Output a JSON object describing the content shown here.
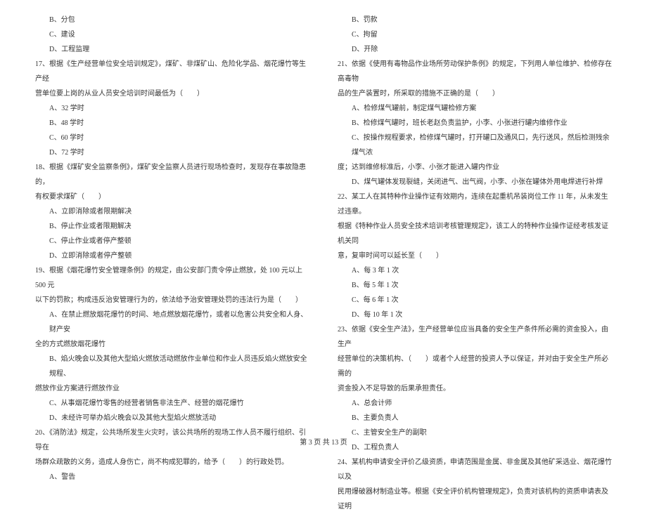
{
  "left": {
    "l1": "B、分包",
    "l2": "C、建设",
    "l3": "D、工程监理",
    "l4": "17、根据《生产经营单位安全培训规定》，煤矿、非煤矿山、危险化学品、烟花爆竹等生产经",
    "l5": "营单位要上岗的从业人员安全培训时间最低为（　　）",
    "l6": "A、32 学时",
    "l7": "B、48 学时",
    "l8": "C、60 学时",
    "l9": "D、72 学时",
    "l10": "18、根据《煤矿安全监察条例》，煤矿安全监察人员进行现场检查时，发现存在事故隐患的，",
    "l11": "有权要求煤矿（　　）",
    "l12": "A、立即消除或者限期解决",
    "l13": "B、停止作业或者限期解决",
    "l14": "C、停止作业或者停产整顿",
    "l15": "D、立即消除或者停产整顿",
    "l16": "19、根据《烟花爆竹安全管理条例》的规定，由公安部门责令停止燃放，处 100 元以上 500 元",
    "l17": "以下的罚款；构成违反治安管理行为的，依法给予治安管理处罚的违法行为是（　　）",
    "l18": "A、在禁止燃放烟花爆竹的时间、地点燃放烟花爆竹，或者以危害公共安全和人身、财产安",
    "l19": "全的方式燃放烟花爆竹",
    "l20": "B、焰火晚会以及其他大型焰火燃放活动燃放作业单位和作业人员违反焰火燃放安全规程、",
    "l21": "燃放作业方案进行燃放作业",
    "l22": "C、从事烟花爆竹零售的经营者销售非法生产、经营的烟花爆竹",
    "l23": "D、未经许可举办焰火晚会以及其他大型焰火燃放活动",
    "l24": "20、《消防法》规定，公共场所发生火灾时，该公共场所的现场工作人员不履行组织、引导在",
    "l25": "场群众疏散的义务，造成人身伤亡，尚不构成犯罪的，给予（　　）的行政处罚。",
    "l26": "A、警告"
  },
  "right": {
    "r1": "B、罚款",
    "r2": "C、拘留",
    "r3": "D、开除",
    "r4": "21、依据《使用有毒物品作业场所劳动保护条例》的规定，下列用人单位维护、检修存在高毒物",
    "r5": "品的生产装置时，所采取的措施不正确的是（　　）",
    "r6": "A、检修煤气罐前，制定煤气罐检修方案",
    "r7": "B、检修煤气罐时，班长老赵负责监护，小李、小张进行罐内维修作业",
    "r8": "C、按操作规程要求，检修煤气罐时，打开罐口及通风口，先行送风，然后检测残余煤气浓",
    "r9": "度；达到维修标准后，小李、小张才能进入罐内作业",
    "r10": "D、煤气罐体发现裂缝，关闭进气、出气阀，小李、小张在罐体外用电焊进行补焊",
    "r11": "22、某工人在其特种作业操作证有效期内，连续在起重机吊装岗位工作 11 年，从未发生过违章。",
    "r12": "根据《特种作业人员安全技术培训考核管理规定》，该工人的特种作业操作证经考核发证机关同",
    "r13": "意，复审时间可以延长至（　　）",
    "r14": "A、每 3 年 1 次",
    "r15": "B、每 5 年 1 次",
    "r16": "C、每 6 年 1 次",
    "r17": "D、每 10 年 1 次",
    "r18": "23、依据《安全生产法》，生产经营单位应当具备的安全生产条件所必需的资金投入，由生产",
    "r19": "经营单位的决策机构、（　　）或者个人经营的投资人予以保证，并对由于安全生产所必需的",
    "r20": "资金投入不足导致的后果承担责任。",
    "r21": "A、总会计师",
    "r22": "B、主要负责人",
    "r23": "C、主管安全生产的副职",
    "r24": "D、工程负责人",
    "r25": "24、某机构申请安全评价乙级资质，申请范围是金属、非金属及其他矿采选业、烟花爆竹以及",
    "r26": "民用爆破器材制造业等。根据《安全评价机构管理规定》，负责对该机构的资质申请表及证明"
  },
  "footer": "第 3 页 共 13 页"
}
